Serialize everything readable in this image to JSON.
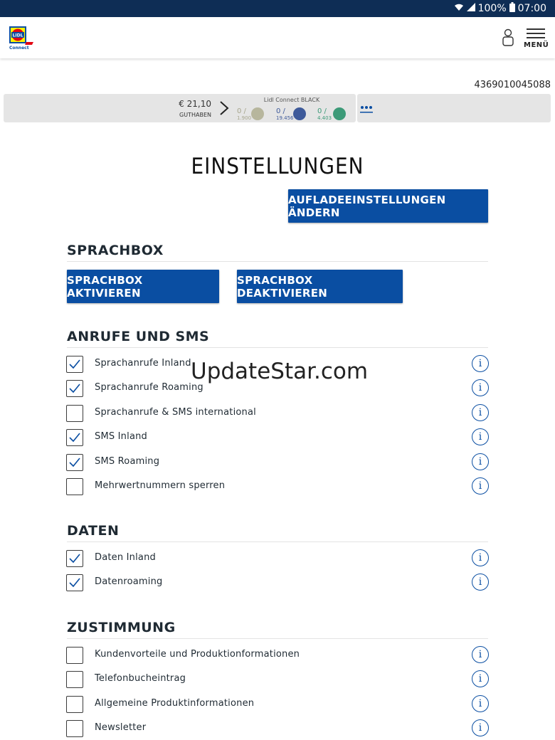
{
  "status_bar": {
    "battery": "100%",
    "time": "07:00",
    "icons": [
      "wifi-icon",
      "signal-icon",
      "battery-icon"
    ]
  },
  "header": {
    "logo_text": "LIDL",
    "logo_sub": "Connect",
    "menu_label": "MENÜ"
  },
  "account": {
    "phone": "4369010045088",
    "credit_amount": "€ 21,10",
    "credit_label": "GUTHABEN",
    "tariff_name": "Lidl Connect BLACK",
    "meters": [
      {
        "used": "0 /",
        "total": "1.900",
        "color": "#b7b69d"
      },
      {
        "used": "0 /",
        "total": "19.456",
        "color": "#3e5a9a"
      },
      {
        "used": "0 /",
        "total": "4.403",
        "color": "#3c9a78"
      }
    ]
  },
  "page_title": "EINSTELLUNGEN",
  "topup_button": "AUFLADEEINSTELLUNGEN ÄNDERN",
  "sprachbox": {
    "heading": "SPRACHBOX",
    "activate": "SPRACHBOX AKTIVIEREN",
    "deactivate": "SPRACHBOX DEAKTIVIEREN"
  },
  "calls": {
    "heading": "ANRUFE UND SMS",
    "items": [
      {
        "label": "Sprachanrufe Inland",
        "checked": true
      },
      {
        "label": "Sprachanrufe Roaming",
        "checked": true
      },
      {
        "label": "Sprachanrufe & SMS international",
        "checked": false
      },
      {
        "label": "SMS Inland",
        "checked": true
      },
      {
        "label": "SMS Roaming",
        "checked": true
      },
      {
        "label": "Mehrwertnummern sperren",
        "checked": false
      }
    ]
  },
  "data": {
    "heading": "DATEN",
    "items": [
      {
        "label": "Daten Inland",
        "checked": true
      },
      {
        "label": "Datenroaming",
        "checked": true
      }
    ]
  },
  "consent": {
    "heading": "ZUSTIMMUNG",
    "items": [
      {
        "label": "Kundenvorteile und Produktionformationen",
        "checked": false
      },
      {
        "label": "Telefonbucheintrag",
        "checked": false
      },
      {
        "label": "Allgemeine Produktinformationen",
        "checked": false
      },
      {
        "label": "Newsletter",
        "checked": false
      }
    ]
  },
  "info_glyph": "i",
  "watermark": "UpdateStar.com",
  "colors": {
    "primary": "#0a4ea2",
    "statusbar": "#0e2d55"
  }
}
